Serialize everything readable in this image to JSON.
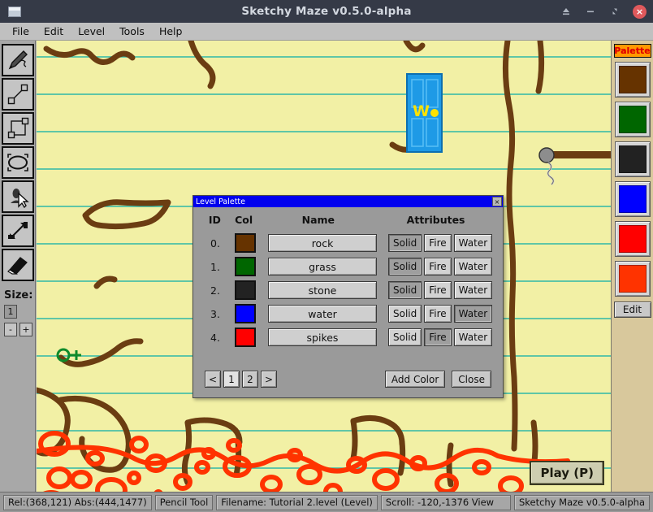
{
  "window": {
    "title": "Sketchy Maze v0.5.0-alpha",
    "app_icon": "window-icon",
    "buttons": [
      {
        "name": "shade-button",
        "glyph": "eject-icon"
      },
      {
        "name": "minimize-button",
        "glyph": "minimize-icon"
      },
      {
        "name": "maximize-button",
        "glyph": "maximize-icon"
      },
      {
        "name": "close-button",
        "glyph": "close-icon",
        "label": "×",
        "color": "#e0595c"
      }
    ]
  },
  "menubar": {
    "items": [
      {
        "label": "File"
      },
      {
        "label": "Edit"
      },
      {
        "label": "Level"
      },
      {
        "label": "Tools"
      },
      {
        "label": "Help"
      }
    ]
  },
  "toolbar": {
    "tools": [
      {
        "name": "pencil-tool",
        "icon": "pencil-icon",
        "selected": true
      },
      {
        "name": "line-tool",
        "icon": "line-icon",
        "selected": false
      },
      {
        "name": "rectangle-tool",
        "icon": "rectangle-icon",
        "selected": false
      },
      {
        "name": "ellipse-tool",
        "icon": "ellipse-icon",
        "selected": false
      },
      {
        "name": "actor-tool",
        "icon": "doodad-cursor-icon",
        "selected": false
      },
      {
        "name": "link-tool",
        "icon": "link-arrow-icon",
        "selected": false
      },
      {
        "name": "eraser-tool",
        "icon": "eraser-icon",
        "selected": false
      }
    ],
    "size_label": "Size:",
    "size_value": "1",
    "size_minus": "-",
    "size_plus": "+"
  },
  "palette_sidebar": {
    "header": "Palette",
    "header_bg": "#ff9900",
    "header_fg": "#e00000",
    "swatches": [
      {
        "name": "palette-swatch-rock",
        "color": "#663300"
      },
      {
        "name": "palette-swatch-grass",
        "color": "#006600"
      },
      {
        "name": "palette-swatch-stone",
        "color": "#222222"
      },
      {
        "name": "palette-swatch-water",
        "color": "#0000ff"
      },
      {
        "name": "palette-swatch-spikes",
        "color": "#ff0000"
      },
      {
        "name": "palette-swatch-fire",
        "color": "#ff3300"
      }
    ],
    "edit_label": "Edit"
  },
  "canvas": {
    "background_color": "#f2f0a5",
    "rule_line_color": "#2fb8a8",
    "play_button": "Play (P)",
    "objects": [
      {
        "name": "blue-door",
        "label": "W"
      },
      {
        "name": "green-key"
      },
      {
        "name": "anvil-ball"
      }
    ]
  },
  "dialog": {
    "title": "Level Palette",
    "close_label": "×",
    "columns": [
      "ID",
      "Col",
      "Name",
      "Attributes"
    ],
    "attribute_names": [
      "Solid",
      "Fire",
      "Water"
    ],
    "rows": [
      {
        "id": "0.",
        "color": "#663300",
        "name": "rock",
        "solid": true,
        "fire": false,
        "water": false
      },
      {
        "id": "1.",
        "color": "#006600",
        "name": "grass",
        "solid": true,
        "fire": false,
        "water": false
      },
      {
        "id": "2.",
        "color": "#222222",
        "name": "stone",
        "solid": true,
        "fire": false,
        "water": false
      },
      {
        "id": "3.",
        "color": "#0000ff",
        "name": "water",
        "solid": false,
        "fire": false,
        "water": true
      },
      {
        "id": "4.",
        "color": "#ff0000",
        "name": "spikes",
        "solid": false,
        "fire": true,
        "water": false
      }
    ],
    "pager": [
      {
        "label": "<",
        "active": false
      },
      {
        "label": "1",
        "active": true
      },
      {
        "label": "2",
        "active": false
      },
      {
        "label": ">",
        "active": false
      }
    ],
    "add_color_label": "Add Color",
    "close_button_label": "Close"
  },
  "statusbar": {
    "cells": [
      {
        "name": "status-coordinates",
        "text": "Rel:(368,121)  Abs:(444,1477)"
      },
      {
        "name": "status-tool",
        "text": "Pencil Tool"
      },
      {
        "name": "status-filename",
        "text": "Filename: Tutorial 2.level (Level)"
      },
      {
        "name": "status-scroll",
        "text": "Scroll: -120,-1376    View"
      },
      {
        "name": "status-version",
        "text": "Sketchy Maze v0.5.0-alpha"
      }
    ]
  }
}
